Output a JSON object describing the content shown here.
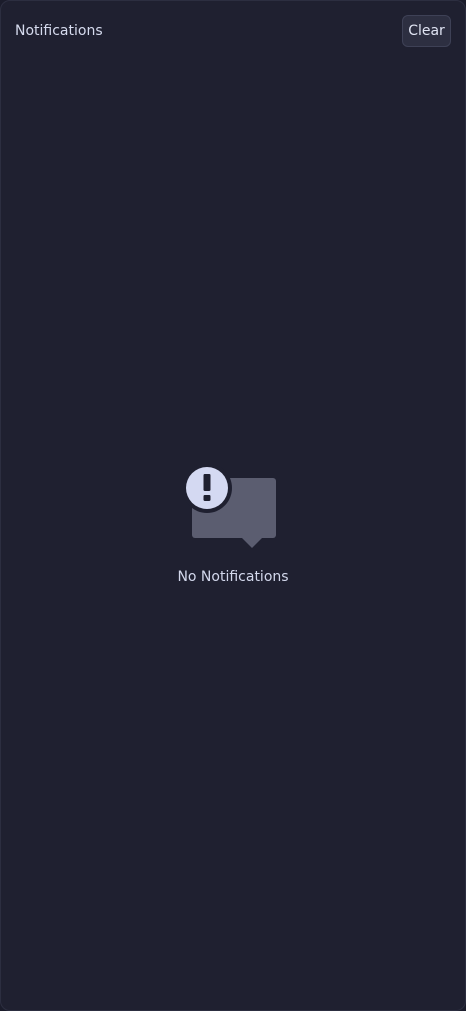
{
  "header": {
    "title": "Notifications",
    "clear_label": "Clear"
  },
  "empty_state": {
    "icon": "notification-alert-icon",
    "message": "No Notifications"
  },
  "colors": {
    "panel_background": "#1f2030",
    "button_background": "#2d2f41",
    "icon_bubble": "#5b5d70",
    "icon_badge": "#d4d9f2"
  }
}
